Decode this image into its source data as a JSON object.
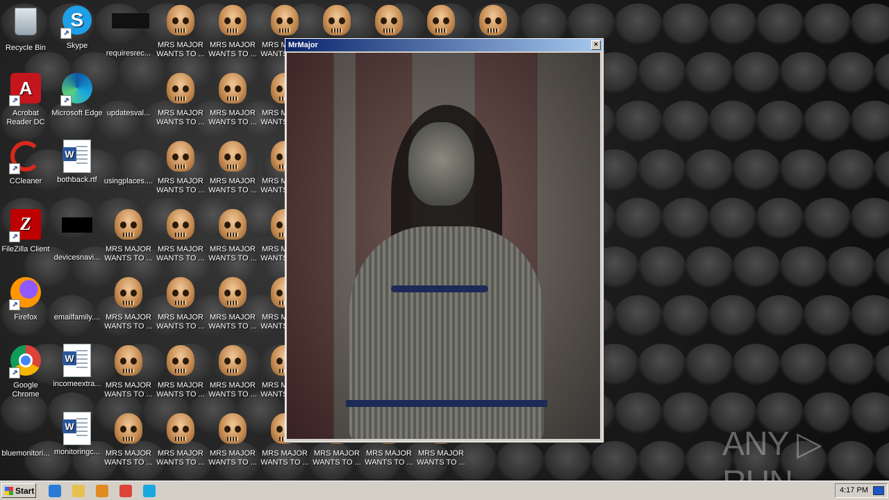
{
  "desktop": {
    "icons": [
      {
        "label": "Recycle Bin",
        "type": "recycle",
        "shortcut": false
      },
      {
        "label": "Skype",
        "type": "skype",
        "shortcut": true
      },
      {
        "label": "requiresrec...",
        "type": "darkbox",
        "shortcut": false
      },
      {
        "label": "Acrobat\nReader DC",
        "type": "acrobat",
        "shortcut": true
      },
      {
        "label": "Microsoft Edge",
        "type": "edge",
        "shortcut": true
      },
      {
        "label": "updatesval...",
        "type": "blank",
        "shortcut": false
      },
      {
        "label": "CCleaner",
        "type": "ccleaner",
        "shortcut": true
      },
      {
        "label": "bothback.rtf",
        "type": "word",
        "shortcut": false
      },
      {
        "label": "usingplaces....",
        "type": "blank",
        "shortcut": false
      },
      {
        "label": "FileZilla Client",
        "type": "filezilla",
        "shortcut": true
      },
      {
        "label": "devicesnavi...",
        "type": "blackbox",
        "shortcut": false
      },
      {
        "label": "Firefox",
        "type": "firefox",
        "shortcut": true
      },
      {
        "label": "emailfamily....",
        "type": "blank",
        "shortcut": false
      },
      {
        "label": "Google\nChrome",
        "type": "chrome",
        "shortcut": true
      },
      {
        "label": "incomeextra...",
        "type": "word",
        "shortcut": false
      },
      {
        "label": "bluemonitori...",
        "type": "blank",
        "shortcut": false
      },
      {
        "label": "monitoringc...",
        "type": "word",
        "shortcut": false
      }
    ],
    "malware_icon_label": "MRS MAJOR\nWANTS TO ...",
    "watermark": "ANY ▷ RUN"
  },
  "popup": {
    "title": "MrMajor",
    "close_symbol": "×"
  },
  "taskbar": {
    "start_label": "Start",
    "quick_launch": [
      {
        "icon": "ie-icon",
        "color": "#2a7ad8"
      },
      {
        "icon": "explorer-folder-icon",
        "color": "#e8c050"
      },
      {
        "icon": "media-player-icon",
        "color": "#e08a20"
      },
      {
        "icon": "chrome-icon",
        "color": "#db4437"
      },
      {
        "icon": "edge-icon",
        "color": "#1ba7e0"
      }
    ],
    "clock": "4:17 PM"
  }
}
